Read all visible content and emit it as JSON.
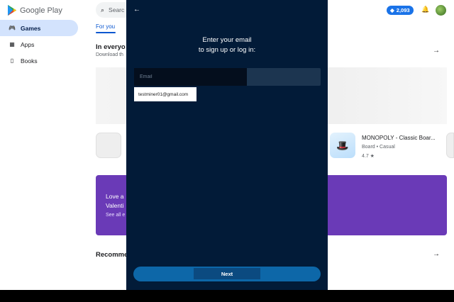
{
  "store": {
    "brand": "Google Play",
    "nav": [
      {
        "label": "Games",
        "icon": "gamepad-icon",
        "active": true
      },
      {
        "label": "Apps",
        "icon": "apps-grid-icon",
        "active": false
      },
      {
        "label": "Books",
        "icon": "book-icon",
        "active": false
      }
    ],
    "search_text": "Searc",
    "coins": "2,093",
    "tabs": {
      "for_you": "For you",
      "fragment": "s"
    },
    "sections": {
      "everyone_title": "In everyo",
      "everyone_sub": "Download th",
      "recommended_title": "Recomme"
    },
    "featured_app": {
      "title": "MONOPOLY - Classic Boar...",
      "category": "Board • Casual",
      "rating": "4.7 ★"
    },
    "promo": {
      "line1": "Love a",
      "line2": "Valenti",
      "line3": "See all e"
    },
    "colors": {
      "accent": "#0b57d0",
      "coins": "#1a73e8",
      "promo": "#6a3ab7"
    }
  },
  "modal": {
    "prompt_line1": "Enter your email",
    "prompt_line2": "to sign up or log in:",
    "email_placeholder": "Email",
    "suggestion": "testminer01@gmail.com",
    "next_label": "Next",
    "colors": {
      "background": "#021b38",
      "button": "#0d67a8"
    }
  }
}
